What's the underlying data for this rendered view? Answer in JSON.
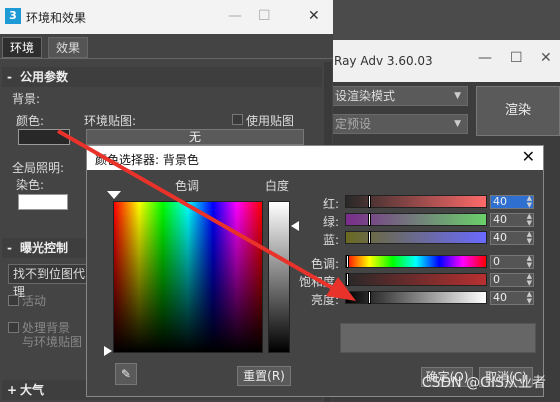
{
  "vray": {
    "title": "Ray Adv 3.60.03",
    "render_mode": "设渲染模式",
    "preset": "定预设",
    "render_label": "渲染"
  },
  "env": {
    "title": "环境和效果",
    "icon_letter": "3",
    "tabs": [
      {
        "label": "环境"
      },
      {
        "label": "效果"
      }
    ],
    "common": {
      "header": "公用参数",
      "sign": "-",
      "bg_group": "背景:",
      "color_label": "颜色:",
      "env_map_label": "环境贴图:",
      "use_map_label": "使用贴图",
      "none_label": "无",
      "global_light_label": "全局照明:",
      "tint_label": "染色:"
    },
    "exposure": {
      "header": "曝光控制",
      "sign": "-",
      "dropdown_value": "找不到位图代理",
      "active_label": "活动",
      "process_bg_line1": "处理背景",
      "process_bg_line2": "与环境贴图",
      "side_text": "黑",
      "side_text2": "度"
    },
    "atmosphere": {
      "header": "大气",
      "sign": "+"
    }
  },
  "picker": {
    "title": "颜色选择器: 背景色",
    "hue_label": "色调",
    "whiteness_label": "白度",
    "black_label": "黑",
    "sliders": [
      {
        "label": "红:",
        "value": "40"
      },
      {
        "label": "绿:",
        "value": "40"
      },
      {
        "label": "蓝:",
        "value": "40"
      },
      {
        "label": "色调:",
        "value": "0"
      },
      {
        "label": "饱和度:",
        "value": "0"
      },
      {
        "label": "亮度:",
        "value": "40"
      }
    ],
    "reset_label": "重置(R)",
    "ok_label": "确定(O)",
    "cancel_label": "取消(C)"
  },
  "watermark": "CSDN @GIS从业者",
  "colors": {
    "arrow": "#e8322a",
    "bg_color_swatch": "#282828",
    "tint_swatch": "#ffffff"
  }
}
